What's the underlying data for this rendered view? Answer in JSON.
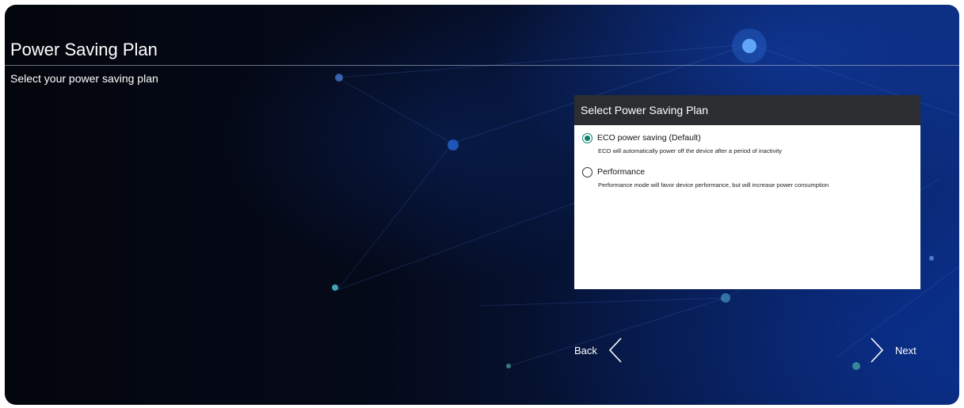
{
  "page": {
    "title": "Power Saving Plan",
    "subtitle": "Select your power saving plan"
  },
  "dialog": {
    "title": "Select Power Saving Plan",
    "options": [
      {
        "label": "ECO power saving (Default)",
        "description": "ECO will automatically power off the device after a period of inactivity",
        "selected": true
      },
      {
        "label": "Performance",
        "description": "Performance mode will favor device performance, but will increase power consumption",
        "selected": false
      }
    ]
  },
  "nav": {
    "back_label": "Back",
    "next_label": "Next"
  },
  "colors": {
    "accent": "#0d7f6d",
    "dialog_header": "#2b2d30"
  },
  "icons": {
    "back": "chevron-left-icon",
    "next": "chevron-right-icon"
  }
}
